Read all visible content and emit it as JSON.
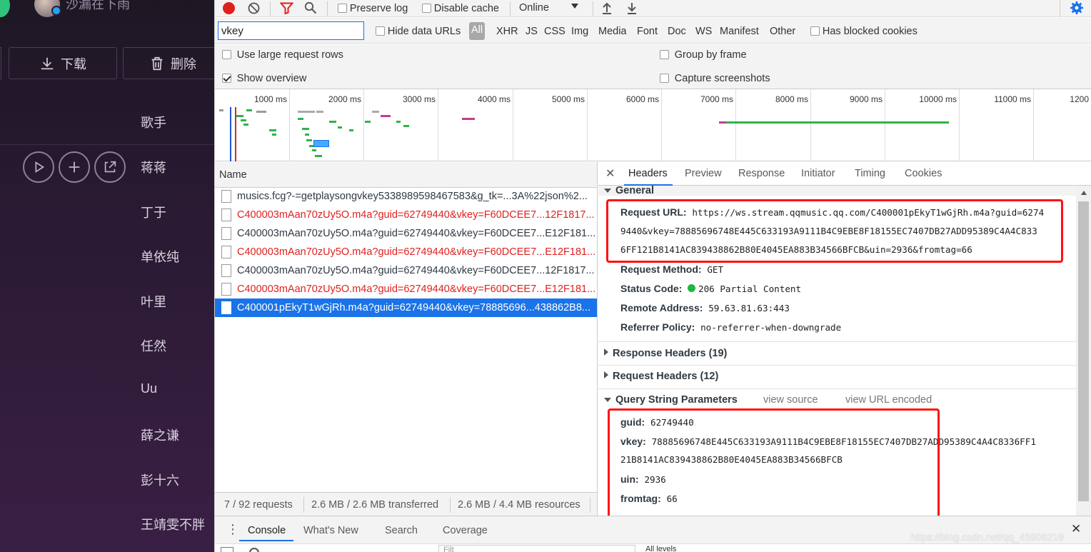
{
  "app": {
    "username": "沙漏在下雨",
    "download_label": "下载",
    "delete_label": "删除",
    "singers": [
      "歌手",
      "蒋蒋",
      "丁于",
      "单依纯",
      "叶里",
      "任然",
      "Uu",
      "薛之谦",
      "彭十六",
      "王靖雯不胖"
    ]
  },
  "toolbar": {
    "preserve_log": "Preserve log",
    "disable_cache": "Disable cache",
    "throttle": "Online"
  },
  "filter": {
    "value": "vkey",
    "hide_data_urls": "Hide data URLs",
    "types": [
      "All",
      "XHR",
      "JS",
      "CSS",
      "Img",
      "Media",
      "Font",
      "Doc",
      "WS",
      "Manifest",
      "Other"
    ],
    "has_blocked_cookies": "Has blocked cookies"
  },
  "settings": {
    "large_rows": "Use large request rows",
    "show_overview": "Show overview",
    "group_by_frame": "Group by frame",
    "capture_screenshots": "Capture screenshots"
  },
  "overview": {
    "ticks": [
      "1000 ms",
      "2000 ms",
      "3000 ms",
      "4000 ms",
      "5000 ms",
      "6000 ms",
      "7000 ms",
      "8000 ms",
      "9000 ms",
      "10000 ms",
      "11000 ms",
      "1200"
    ]
  },
  "requests": {
    "column": "Name",
    "rows": [
      {
        "name": "musics.fcg?-=getplaysongvkey5338989598467583&g_tk=...3A%22json%2...",
        "status": "ok"
      },
      {
        "name": "C400003mAan70zUy5O.m4a?guid=62749440&vkey=F60DCEE7...12F1817...",
        "status": "error"
      },
      {
        "name": "C400003mAan70zUy5O.m4a?guid=62749440&vkey=F60DCEE7...E12F181...",
        "status": "ok"
      },
      {
        "name": "C400003mAan70zUy5O.m4a?guid=62749440&vkey=F60DCEE7...E12F181...",
        "status": "error"
      },
      {
        "name": "C400003mAan70zUy5O.m4a?guid=62749440&vkey=F60DCEE7...12F1817...",
        "status": "ok"
      },
      {
        "name": "C400003mAan70zUy5O.m4a?guid=62749440&vkey=F60DCEE7...E12F181...",
        "status": "error"
      },
      {
        "name": "C400001pEkyT1wGjRh.m4a?guid=62749440&vkey=78885696...438862B8...",
        "status": "selected"
      }
    ],
    "summary": [
      "7 / 92 requests",
      "2.6 MB / 2.6 MB transferred",
      "2.6 MB / 4.4 MB resources"
    ]
  },
  "details": {
    "tabs": [
      "Headers",
      "Preview",
      "Response",
      "Initiator",
      "Timing",
      "Cookies"
    ],
    "general_title": "General",
    "request_url_label": "Request URL:",
    "request_url_lines": [
      "https://ws.stream.qqmusic.qq.com/C400001pEkyT1wGjRh.m4a?guid=6274",
      "9440&vkey=78885696748E445C633193A9111B4C9EBE8F18155EC7407DB27ADD95389C4A4C833",
      "6FF121B8141AC839438862B80E4045EA883B34566BFCB&uin=2936&fromtag=66"
    ],
    "request_method_label": "Request Method:",
    "request_method": "GET",
    "status_code_label": "Status Code:",
    "status_code": "206 Partial Content",
    "remote_address_label": "Remote Address:",
    "remote_address": "59.63.81.63:443",
    "referrer_policy_label": "Referrer Policy:",
    "referrer_policy": "no-referrer-when-downgrade",
    "response_headers": "Response Headers (19)",
    "request_headers": "Request Headers (12)",
    "query_title": "Query String Parameters",
    "view_source": "view source",
    "view_url_encoded": "view URL encoded",
    "guid_label": "guid:",
    "guid": "62749440",
    "vkey_label": "vkey:",
    "vkey_lines": [
      "78885696748E445C633193A9111B4C9EBE8F18155EC7407DB27ADD95389C4A4C8336FF1",
      "21B8141AC839438862B80E4045EA883B34566BFCB"
    ],
    "uin_label": "uin:",
    "uin": "2936",
    "fromtag_label": "fromtag:",
    "fromtag": "66"
  },
  "drawer": {
    "tabs": [
      "Console",
      "What's New",
      "Search",
      "Coverage"
    ],
    "filter_placeholder": "Filt",
    "levels": "All levels"
  },
  "watermark": "https://blog.csdn.net/qq_45906219",
  "colors": {
    "accent": "#1a73e8",
    "error": "#e0201f",
    "highlight_box": "#ff1010",
    "record": "#e0201f"
  }
}
